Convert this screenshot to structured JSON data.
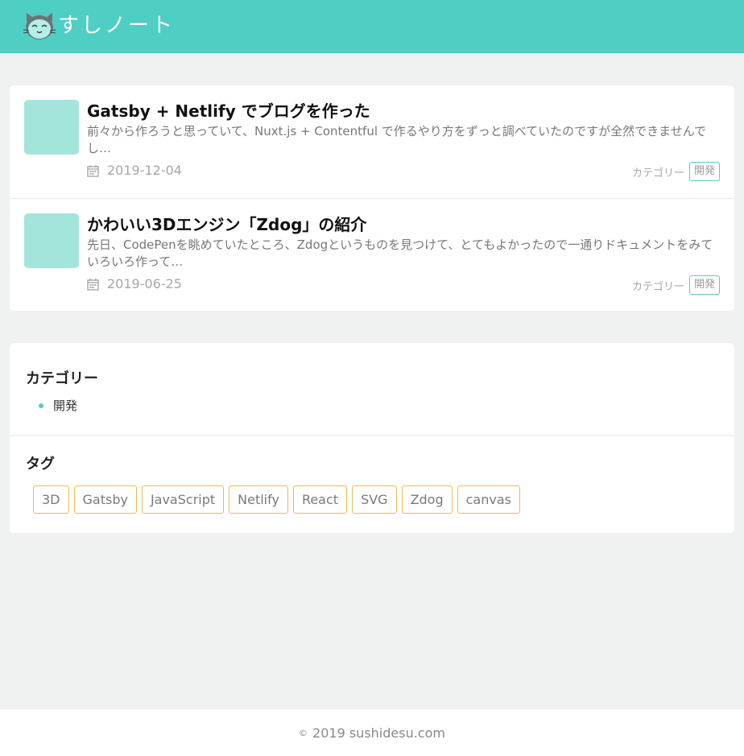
{
  "site": {
    "title": "すしノート",
    "icon": "cat-logo-icon"
  },
  "colors": {
    "accent": "#4fcec4",
    "thumbnail": "#a4e5db",
    "tag_border": "#e9bc52",
    "background": "#f0f1f1"
  },
  "posts": [
    {
      "title": "Gatsby + Netlify でブログを作った",
      "excerpt": "前々から作ろうと思っていて、Nuxt.js + Contentful で作るやり方をずっと調べていたのですが全然できませんでし…",
      "date": "2019-12-04",
      "category_label": "カテゴリー",
      "category": "開発"
    },
    {
      "title": "かわいい3Dエンジン「Zdog」の紹介",
      "excerpt": "先日、CodePenを眺めていたところ、Zdogというものを見つけて、とてもよかったので一通りドキュメントをみていろいろ作って…",
      "date": "2019-06-25",
      "category_label": "カテゴリー",
      "category": "開発"
    }
  ],
  "sidebar": {
    "categories": {
      "title": "カテゴリー",
      "items": [
        "開発"
      ]
    },
    "tags": {
      "title": "タグ",
      "items": [
        "3D",
        "Gatsby",
        "JavaScript",
        "Netlify",
        "React",
        "SVG",
        "Zdog",
        "canvas"
      ]
    }
  },
  "footer": {
    "copyright_symbol": "©",
    "text": "2019 sushidesu.com"
  }
}
